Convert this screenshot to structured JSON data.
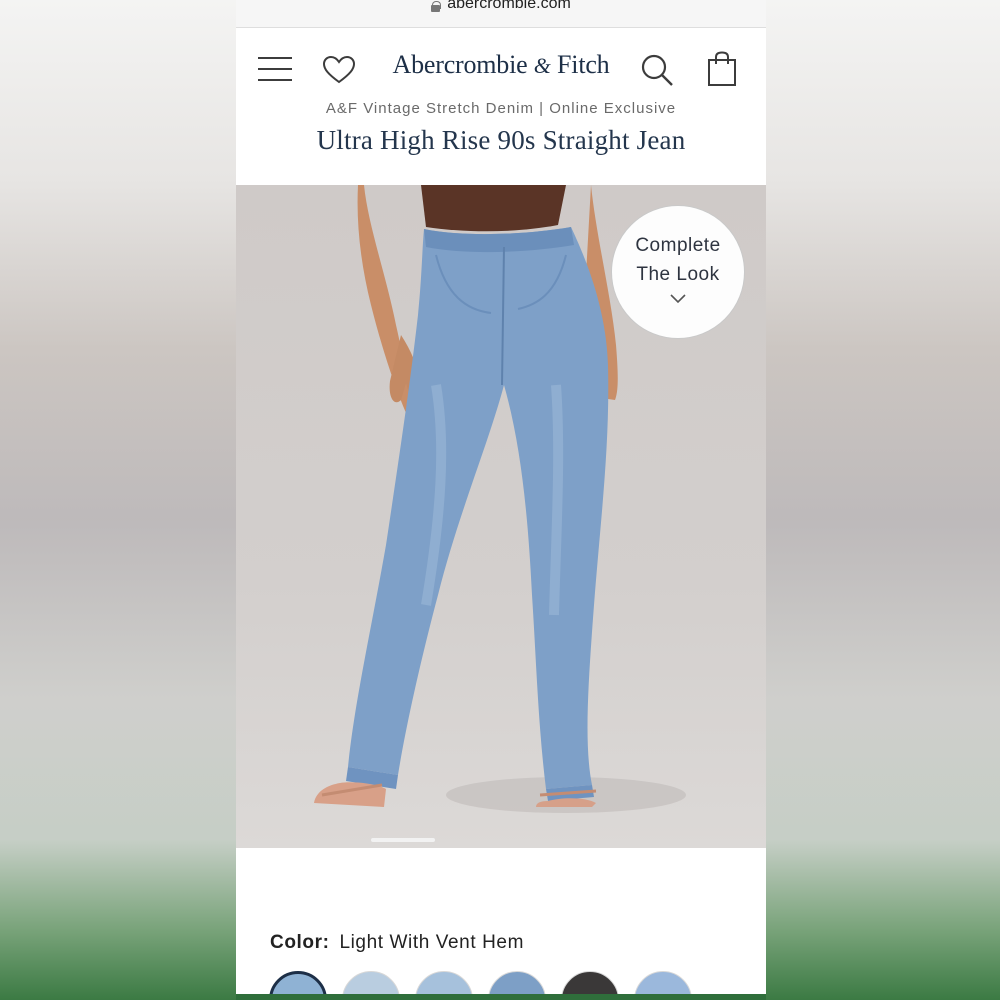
{
  "browser": {
    "url": "abercrombie.com"
  },
  "header": {
    "brand_main": "Abercrombie",
    "brand_amp": "&",
    "brand_end": "Fitch"
  },
  "product": {
    "subtitle": "A&F Vintage Stretch Denim | Online Exclusive",
    "title": "Ultra High Rise 90s Straight Jean"
  },
  "hero": {
    "complete_look_line1": "Complete",
    "complete_look_line2": "The Look",
    "carousel_active_index": 1
  },
  "color": {
    "label": "Color:",
    "value": "Light With Vent Hem",
    "swatches": [
      {
        "color": "#8fb2d4",
        "selected": true
      },
      {
        "color": "#b9cde0",
        "selected": false
      },
      {
        "color": "#a6c1dc",
        "selected": false
      },
      {
        "color": "#7d9fc6",
        "selected": false
      },
      {
        "color": "#3a3838",
        "selected": false
      },
      {
        "color": "#9bb8dc",
        "selected": false
      }
    ]
  },
  "colors": {
    "brand_navy": "#1d2f47",
    "hero_bg": "#cfcac8",
    "denim": "#7ea0c8"
  }
}
